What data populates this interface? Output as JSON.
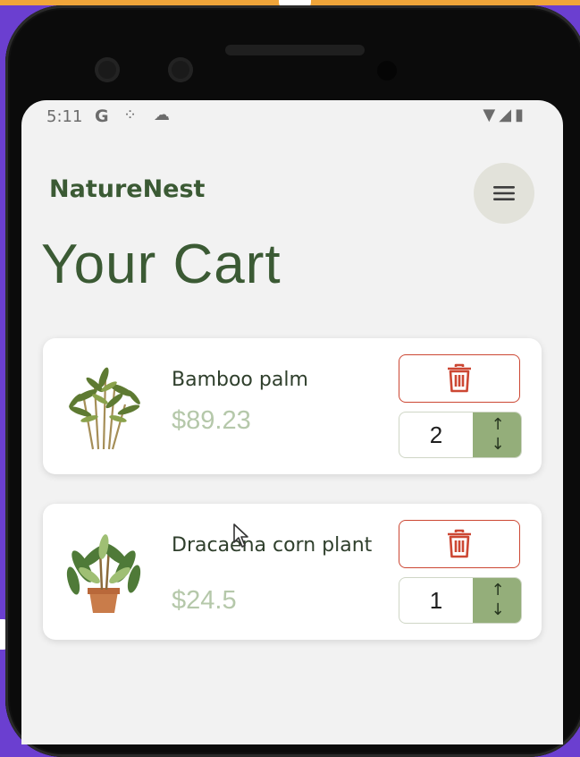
{
  "status_bar": {
    "time": "5:11",
    "google_glyph": "G",
    "icons": [
      "signal-dots-icon",
      "cloud-icon",
      "wifi-icon",
      "cell-icon",
      "battery-icon"
    ]
  },
  "app": {
    "brand": "NatureNest",
    "menu_icon": "hamburger-menu-icon",
    "page_title": "Your Cart"
  },
  "cart": {
    "items": [
      {
        "name": "Bamboo palm",
        "price": "$89.23",
        "quantity": "2",
        "delete_icon": "trash-icon",
        "stepper_up": "↑",
        "stepper_down": "↓"
      },
      {
        "name": "Dracaena corn plant",
        "price": "$24.5",
        "quantity": "1",
        "delete_icon": "trash-icon",
        "stepper_up": "↑",
        "stepper_down": "↓"
      }
    ]
  },
  "colors": {
    "brand_green": "#3b5a34",
    "price_green": "#b5c8aa",
    "stepper_green": "#94ae7a",
    "delete_red": "#cc4733",
    "screen_bg": "#f2f2f2"
  }
}
